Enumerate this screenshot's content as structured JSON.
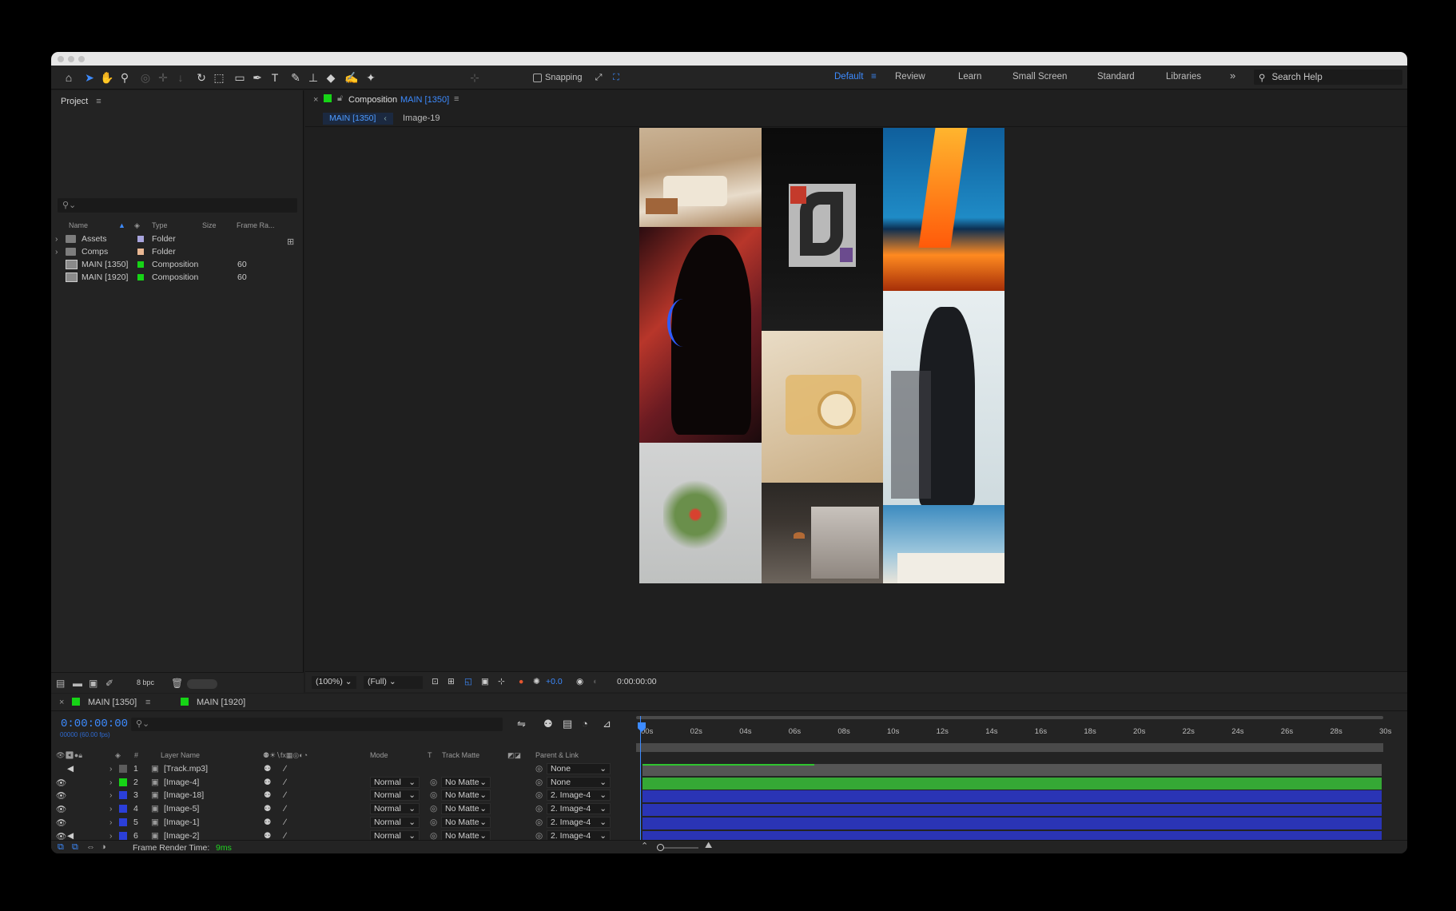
{
  "toolbar": {
    "snapping_label": "Snapping",
    "workspaces": [
      "Default",
      "Review",
      "Learn",
      "Small Screen",
      "Standard",
      "Libraries"
    ],
    "search_placeholder": "Search Help"
  },
  "project": {
    "title": "Project",
    "columns": {
      "name": "Name",
      "type": "Type",
      "size": "Size",
      "frame_rate": "Frame Ra..."
    },
    "items": [
      {
        "name": "Assets",
        "type": "Folder",
        "size": "",
        "frame_rate": "",
        "label_color": "#a8a4dd"
      },
      {
        "name": "Comps",
        "type": "Folder",
        "size": "",
        "frame_rate": "",
        "label_color": "#e9b793"
      },
      {
        "name": "MAIN [1350]",
        "type": "Composition",
        "size": "",
        "frame_rate": "60",
        "label_color": "#16d416"
      },
      {
        "name": "MAIN [1920]",
        "type": "Composition",
        "size": "",
        "frame_rate": "60",
        "label_color": "#16d416"
      }
    ],
    "bpc": "8 bpc"
  },
  "viewer": {
    "tab_prefix": "Composition",
    "tab_name": "MAIN [1350]",
    "breadcrumb_active": "MAIN [1350]",
    "breadcrumb_next": "Image-19",
    "zoom": "(100%)",
    "resolution": "(Full)",
    "exposure": "+0.0",
    "timecode": "0:00:00:00"
  },
  "timeline": {
    "tabs": [
      "MAIN [1350]",
      "MAIN [1920]"
    ],
    "timecode": "0:00:00:00",
    "fps": "00000 (60.00 fps)",
    "columns": {
      "num": "#",
      "layer_name": "Layer Name",
      "mode": "Mode",
      "t": "T",
      "track_matte": "Track Matte",
      "parent": "Parent & Link"
    },
    "layers": [
      {
        "num": "1",
        "name": "[Track.mp3]",
        "mode": "",
        "matte": "",
        "parent": "None",
        "label_color": "#5c5c5c",
        "audio": true
      },
      {
        "num": "2",
        "name": "[Image-4]",
        "mode": "Normal",
        "matte": "No Matte",
        "parent": "None",
        "label_color": "#16d416",
        "audio": false
      },
      {
        "num": "3",
        "name": "[Image-18]",
        "mode": "Normal",
        "matte": "No Matte",
        "parent": "2. Image-4",
        "label_color": "#2b3fd9",
        "audio": false
      },
      {
        "num": "4",
        "name": "[Image-5]",
        "mode": "Normal",
        "matte": "No Matte",
        "parent": "2. Image-4",
        "label_color": "#2b3fd9",
        "audio": false
      },
      {
        "num": "5",
        "name": "[Image-1]",
        "mode": "Normal",
        "matte": "No Matte",
        "parent": "2. Image-4",
        "label_color": "#2b3fd9",
        "audio": false
      },
      {
        "num": "6",
        "name": "[Image-2]",
        "mode": "Normal",
        "matte": "No Matte",
        "parent": "2. Image-4",
        "label_color": "#2b3fd9",
        "audio": true
      }
    ],
    "ruler_ticks": [
      "00s",
      "02s",
      "04s",
      "06s",
      "08s",
      "10s",
      "12s",
      "14s",
      "16s",
      "18s",
      "20s",
      "22s",
      "24s",
      "26s",
      "28s",
      "30s"
    ],
    "frame_render_label": "Frame Render Time:",
    "frame_render_value": "9ms"
  },
  "colors": {
    "accent": "#3d8bff",
    "composition_green": "#16d416",
    "layer_blue": "#2b3fd9"
  }
}
